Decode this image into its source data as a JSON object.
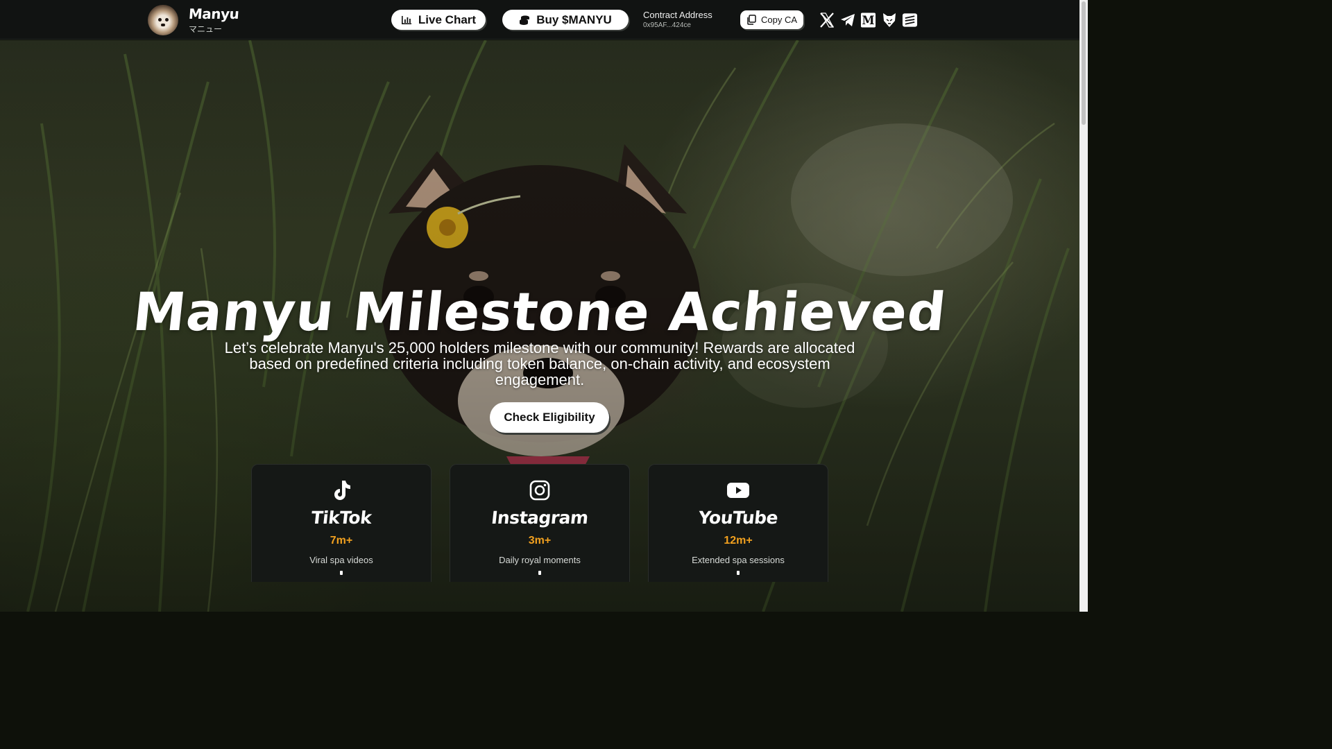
{
  "brand": {
    "name": "Manyu",
    "subtitle": "マニュー"
  },
  "nav": {
    "live_chart": "Live Chart",
    "buy": "Buy $MANYU",
    "contract_title": "Contract Address",
    "contract_address": "0x95AF...424ce",
    "copy_ca": "Copy CA"
  },
  "socials": [
    "x-icon",
    "telegram-icon",
    "m-icon",
    "fox-icon",
    "exchange-icon"
  ],
  "hero": {
    "title": "Manyu Milestone Achieved",
    "description": "Let’s celebrate Manyu's 25,000 holders milestone with our community! Rewards are allocated based on predefined criteria including token balance, on-chain activity, and ecosystem engagement.",
    "cta": "Check Eligibility"
  },
  "cards": [
    {
      "icon": "tiktok-icon",
      "name": "TikTok",
      "stat": "7m+",
      "desc": "Viral spa videos"
    },
    {
      "icon": "instagram-icon",
      "name": "Instagram",
      "stat": "3m+",
      "desc": "Daily royal moments"
    },
    {
      "icon": "youtube-icon",
      "name": "YouTube",
      "stat": "12m+",
      "desc": "Extended spa sessions"
    }
  ],
  "colors": {
    "accent": "#f1a01f",
    "header_bg": "#111312",
    "card_bg": "#151816"
  }
}
